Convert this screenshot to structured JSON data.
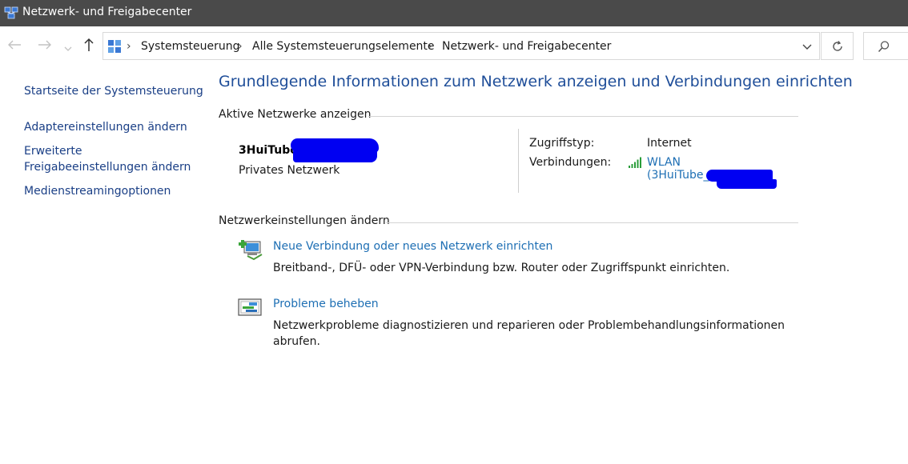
{
  "window": {
    "title": "Netzwerk- und Freigabecenter"
  },
  "nav": {
    "back_icon": "arrow-left-icon",
    "forward_icon": "arrow-right-icon",
    "recent_icon": "chevron-down-icon",
    "up_icon": "arrow-up-icon",
    "breadcrumb": [
      "Systemsteuerung",
      "Alle Systemsteuerungselemente",
      "Netzwerk- und Freigabecenter"
    ],
    "separator": "›",
    "refresh_icon": "refresh-icon",
    "search_icon": "search-icon"
  },
  "sidebar": {
    "items": [
      {
        "label": "Startseite der Systemsteuerung"
      },
      {
        "label": "Adaptereinstellungen ändern"
      },
      {
        "label_line1": "Erweiterte",
        "label_line2": "Freigabeeinstellungen ändern"
      },
      {
        "label": "Medienstreamingoptionen"
      }
    ]
  },
  "main": {
    "title": "Grundlegende Informationen zum Netzwerk anzeigen und Verbindungen einrichten",
    "active_networks": {
      "heading": "Aktive Netzwerke anzeigen",
      "network_name": "3HuiTube_",
      "network_type": "Privates Netzwerk",
      "access_label": "Zugriffstyp:",
      "access_value": "Internet",
      "connections_label": "Verbindungen:",
      "connection_link_line1": "WLAN",
      "connection_link_line2": "(3HuiTube_"
    },
    "change_settings": {
      "heading": "Netzwerkeinstellungen ändern",
      "tasks": [
        {
          "icon": "new-connection-icon",
          "link": "Neue Verbindung oder neues Netzwerk einrichten",
          "description": "Breitband-, DFÜ- oder VPN-Verbindung bzw. Router oder Zugriffspunkt einrichten."
        },
        {
          "icon": "troubleshoot-icon",
          "link": "Probleme beheben",
          "description": "Netzwerkprobleme diagnostizieren und reparieren oder Problembehandlungsinformationen abrufen."
        }
      ]
    }
  },
  "colors": {
    "titlebar": "#4a4a4a",
    "link": "#1e6fb4",
    "title": "#1f4e99",
    "sidebar_link": "#1a3f86",
    "redaction": "#0000f2"
  }
}
